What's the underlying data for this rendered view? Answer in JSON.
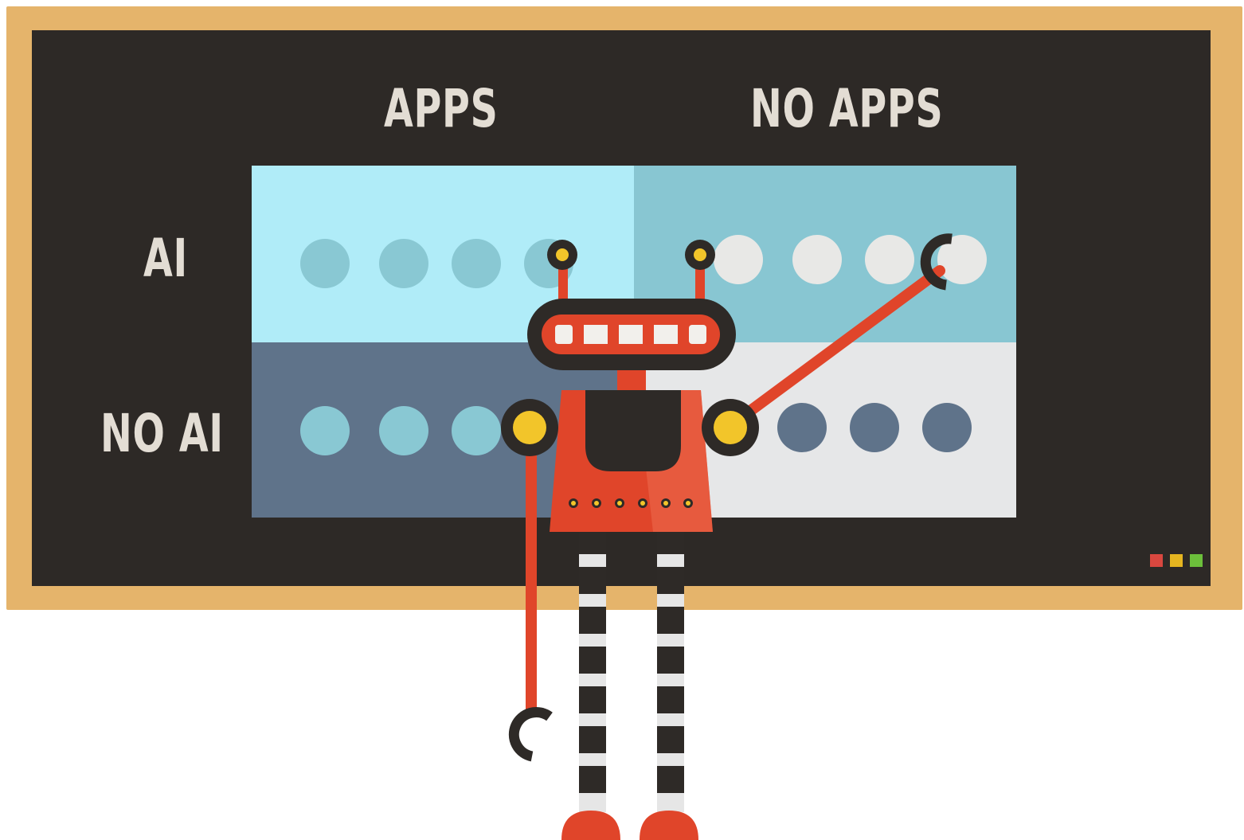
{
  "matrix": {
    "columns": [
      "APPS",
      "NO APPS"
    ],
    "rows": [
      "AI",
      "NO AI"
    ]
  },
  "colors": {
    "frame": "#e5b46b",
    "board": "#2d2926",
    "quadrant_ai_apps": "#b0ecf8",
    "quadrant_ai_noapps": "#88c6d2",
    "quadrant_noai_apps": "#5f738a",
    "quadrant_noai_noapps": "#e6e7e8",
    "robot_body": "#e0452a",
    "robot_dark": "#2e2a27",
    "robot_accent": "#f2c52a",
    "label": "#e3ddd4"
  },
  "status_lights": [
    "#d9473f",
    "#e5b520",
    "#6cbf3b"
  ],
  "icons": [
    "robot-illustration",
    "status-lights"
  ]
}
